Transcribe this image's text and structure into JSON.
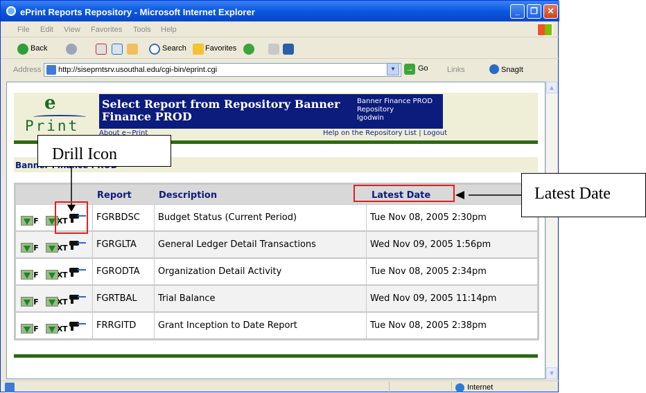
{
  "window": {
    "title": "ePrint Reports Repository - Microsoft Internet Explorer",
    "min": "_",
    "max": "❐",
    "close": "✕"
  },
  "menu": [
    "File",
    "Edit",
    "View",
    "Favorites",
    "Tools",
    "Help"
  ],
  "toolbar": {
    "back": "Back",
    "search": "Search",
    "favorites": "Favorites"
  },
  "address": {
    "label": "Address",
    "url": "http://siseprntsrv.usouthal.edu/cgi-bin/eprint.cgi",
    "go": "Go",
    "links": "Links",
    "snagit": "SnagIt"
  },
  "status": {
    "zone": "Internet"
  },
  "page": {
    "logo_e": "e",
    "logo_print": "Print",
    "banner_title": "Select Report from Repository Banner Finance PROD",
    "banner_side": [
      "Banner Finance PROD",
      "Repository",
      "lgodwin"
    ],
    "about": "About e~Print",
    "help": "Help on the Repository List | Logout",
    "section_label": "Banner Finance PROD"
  },
  "table": {
    "headers": {
      "report": "Report",
      "description": "Description",
      "latest_date": "Latest Date"
    },
    "icon_labels": {
      "pdf": "PDF",
      "text": "TEXT"
    },
    "rows": [
      {
        "report": "FGRBDSC",
        "description": "Budget Status (Current Period)",
        "date": "Tue Nov 08, 2005 2:30pm"
      },
      {
        "report": "FGRGLTA",
        "description": "General Ledger Detail Transactions",
        "date": "Wed Nov 09, 2005 1:56pm"
      },
      {
        "report": "FGRODTA",
        "description": "Organization Detail Activity",
        "date": "Tue Nov 08, 2005 2:34pm"
      },
      {
        "report": "FGRTBAL",
        "description": "Trial Balance",
        "date": "Wed Nov 09, 2005 11:14pm"
      },
      {
        "report": "FRRGITD",
        "description": "Grant Inception to Date Report",
        "date": "Tue Nov 08, 2005 2:38pm"
      }
    ]
  },
  "annotations": {
    "drill_icon": "Drill Icon",
    "latest_date": "Latest Date"
  },
  "colors": {
    "banner_blue": "#0c1c7c",
    "accent_green": "#2f6818",
    "callout_red": "#e02020"
  }
}
